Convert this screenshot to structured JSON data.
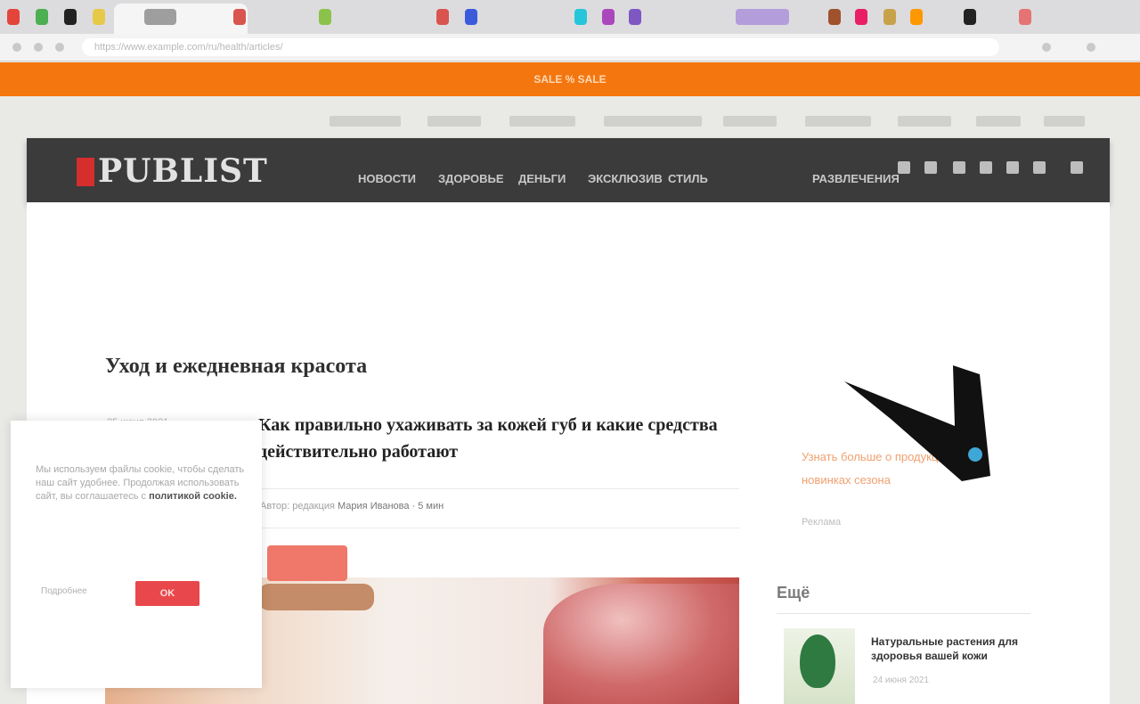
{
  "browser": {
    "url": "https://www.example.com/ru/health/articles/",
    "tab_colors": [
      "#e4453b",
      "#4caf50",
      "#222222",
      "#e7c94a",
      "#d9534f",
      "#3b5bdb",
      "#26c6da",
      "#ab47bc",
      "#7e57c2",
      "#8bc34a",
      "#ff9800",
      "#607d8b",
      "#e91e63"
    ]
  },
  "promo_bar": {
    "text": "SALE  %  SALE",
    "color": "#f4760f"
  },
  "site": {
    "logo": "PUBLIST",
    "nav": [
      "НОВОСТИ",
      "ЗДОРОВЬЕ",
      "ДЕНЬГИ",
      "ЭКСКЛЮЗИВ",
      "СТИЛЬ",
      "РАЗВЛЕЧЕНИЯ"
    ],
    "top_links": 9
  },
  "article": {
    "section": "Уход и ежедневная красота",
    "meta": "25 июня 2021",
    "headline": "Как правильно ухаживать за кожей губ и какие средства действительно работают",
    "byline_prefix": "Автор: редакция",
    "byline_name": "Мария Иванова · 5 мин"
  },
  "sidebar": {
    "promo_text": "Узнать больше о продукции и новинках сезона",
    "promo_sub": "Реклама",
    "heading": "Ещё",
    "item_title": "Натуральные растения для здоровья вашей кожи",
    "item_date": "24 июня 2021"
  },
  "cookie": {
    "text": "Мы используем файлы cookie, чтобы сделать наш сайт удобнее. Продолжая использовать сайт, вы соглашаетесь с",
    "link": "политикой cookie.",
    "more": "Подробнее",
    "accept": "OK"
  },
  "colors": {
    "accent": "#f4760f",
    "header": "#3b3b3b",
    "button": "#e8484b"
  }
}
